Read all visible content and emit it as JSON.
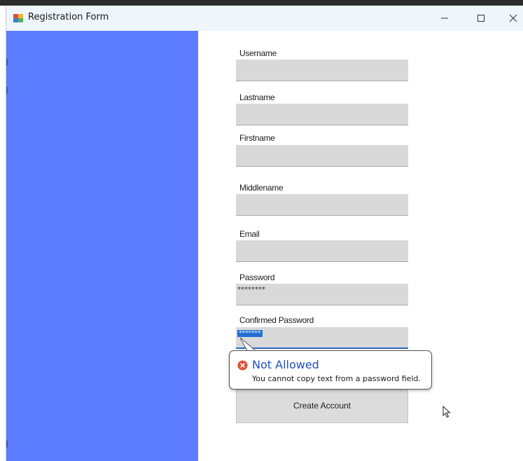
{
  "window": {
    "title": "Registration Form"
  },
  "form": {
    "username_label": "Username",
    "lastname_label": "Lastname",
    "firstname_label": "Firstname",
    "middlename_label": "Middlename",
    "email_label": "Email",
    "password_label": "Password",
    "password_value": "********",
    "confirm_label": "Confirmed Password",
    "confirm_value": "*******",
    "create_button": "Create Account"
  },
  "tooltip": {
    "title": "Not Allowed",
    "message": "You cannot copy text from a password field.",
    "icon": "error-icon"
  },
  "colors": {
    "sidebar": "#5c7dff",
    "field": "#d9d9d9",
    "tooltip_title": "#1f4fbf",
    "error_icon": "#e0533a"
  }
}
